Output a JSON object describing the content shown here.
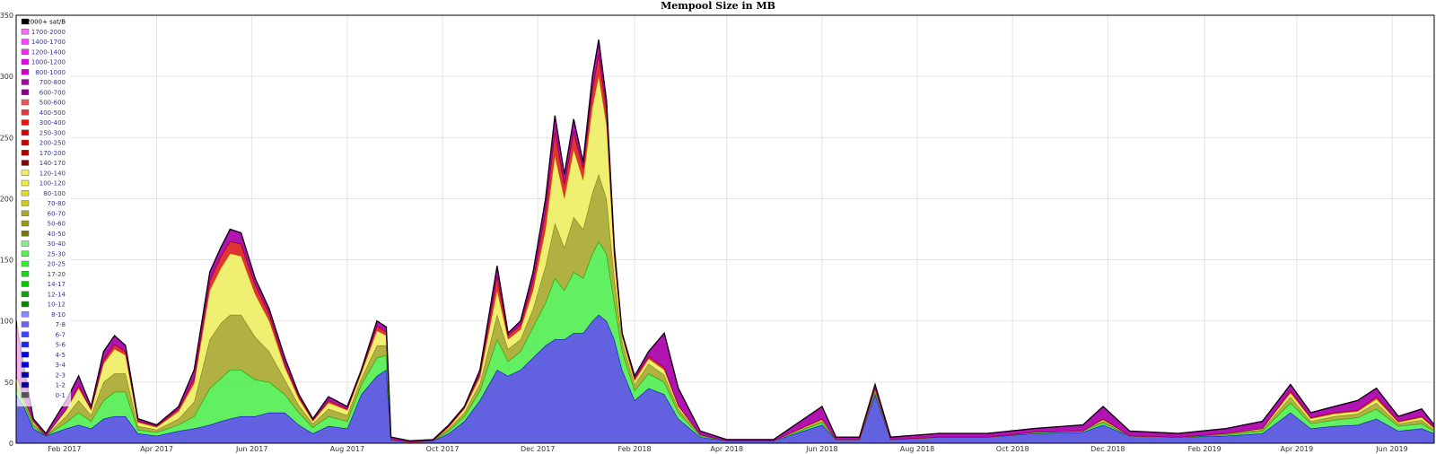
{
  "chart_data": {
    "type": "area",
    "title": "Mempool Size in MB",
    "xlabel": "",
    "ylabel": "",
    "stacked": true,
    "ylim": [
      0,
      350
    ],
    "yticks": [
      0,
      50,
      100,
      150,
      200,
      250,
      300,
      350
    ],
    "xlim": [
      "2017-01-01",
      "2019-06-28"
    ],
    "xticks": [
      {
        "date": "2017-02-01",
        "label": "Feb 2017"
      },
      {
        "date": "2017-04-01",
        "label": "Apr 2017"
      },
      {
        "date": "2017-06-01",
        "label": "Jun 2017"
      },
      {
        "date": "2017-08-01",
        "label": "Aug 2017"
      },
      {
        "date": "2017-10-01",
        "label": "Oct 2017"
      },
      {
        "date": "2017-12-01",
        "label": "Dec 2017"
      },
      {
        "date": "2018-02-01",
        "label": "Feb 2018"
      },
      {
        "date": "2018-04-01",
        "label": "Apr 2018"
      },
      {
        "date": "2018-06-01",
        "label": "Jun 2018"
      },
      {
        "date": "2018-08-01",
        "label": "Aug 2018"
      },
      {
        "date": "2018-10-01",
        "label": "Oct 2018"
      },
      {
        "date": "2018-12-01",
        "label": "Dec 2018"
      },
      {
        "date": "2019-02-01",
        "label": "Feb 2019"
      },
      {
        "date": "2019-04-01",
        "label": "Apr 2019"
      },
      {
        "date": "2019-06-01",
        "label": "Jun 2019"
      }
    ],
    "grid": true,
    "legend_position": "top-left",
    "legend": [
      {
        "label": "2000+ sat/B",
        "color": "#000000"
      },
      {
        "label": "1700-2000",
        "color": "#ff66ff"
      },
      {
        "label": "1400-1700",
        "color": "#ff44ff"
      },
      {
        "label": "1200-1400",
        "color": "#ff22ff"
      },
      {
        "label": "1000-1200",
        "color": "#ee00ee"
      },
      {
        "label": "800-1000",
        "color": "#cc00cc"
      },
      {
        "label": "700-800",
        "color": "#aa00aa"
      },
      {
        "label": "600-700",
        "color": "#880088"
      },
      {
        "label": "500-600",
        "color": "#ee5555"
      },
      {
        "label": "400-500",
        "color": "#ee3333"
      },
      {
        "label": "300-400",
        "color": "#ee1111"
      },
      {
        "label": "250-300",
        "color": "#dd0000"
      },
      {
        "label": "200-250",
        "color": "#cc0000"
      },
      {
        "label": "170-200",
        "color": "#aa0000"
      },
      {
        "label": "140-170",
        "color": "#880000"
      },
      {
        "label": "120-140",
        "color": "#eeee66"
      },
      {
        "label": "100-120",
        "color": "#eeee44"
      },
      {
        "label": "80-100",
        "color": "#dddd22"
      },
      {
        "label": "70-80",
        "color": "#cccc22"
      },
      {
        "label": "60-70",
        "color": "#aaaa22"
      },
      {
        "label": "50-60",
        "color": "#999911"
      },
      {
        "label": "40-50",
        "color": "#777711"
      },
      {
        "label": "30-40",
        "color": "#88ee88"
      },
      {
        "label": "25-30",
        "color": "#55ee55"
      },
      {
        "label": "20-25",
        "color": "#33ee33"
      },
      {
        "label": "17-20",
        "color": "#11dd11"
      },
      {
        "label": "14-17",
        "color": "#00cc00"
      },
      {
        "label": "12-14",
        "color": "#00aa00"
      },
      {
        "label": "10-12",
        "color": "#008800"
      },
      {
        "label": "8-10",
        "color": "#8888ff"
      },
      {
        "label": "7-8",
        "color": "#6666ff"
      },
      {
        "label": "6-7",
        "color": "#4444ff"
      },
      {
        "label": "5-6",
        "color": "#2222ff"
      },
      {
        "label": "4-5",
        "color": "#0000ff"
      },
      {
        "label": "3-4",
        "color": "#0000dd"
      },
      {
        "label": "2-3",
        "color": "#0000bb"
      },
      {
        "label": "1-2",
        "color": "#000099"
      },
      {
        "label": "0-1",
        "color": "#555555"
      }
    ],
    "series_groups": [
      {
        "name": "blue",
        "color": "#5555dd",
        "line": "#0000cc"
      },
      {
        "name": "green",
        "color": "#55ee55",
        "line": "#00aa00"
      },
      {
        "name": "olive",
        "color": "#aaaa33",
        "line": "#777711"
      },
      {
        "name": "yellow",
        "color": "#eeee66",
        "line": "#cccc22"
      },
      {
        "name": "red",
        "color": "#dd2222",
        "line": "#880000"
      },
      {
        "name": "purple",
        "color": "#aa00aa",
        "line": "#330033"
      }
    ],
    "points": [
      {
        "date": "2017-01-01",
        "total": 100,
        "blue": 40,
        "green": 5,
        "olive": 5,
        "yellow": 5,
        "red": 0
      },
      {
        "date": "2017-01-06",
        "total": 62,
        "blue": 30,
        "green": 3,
        "olive": 2,
        "yellow": 2,
        "red": 0
      },
      {
        "date": "2017-01-12",
        "total": 20,
        "blue": 12,
        "green": 2,
        "olive": 2,
        "yellow": 2,
        "red": 0
      },
      {
        "date": "2017-01-20",
        "total": 8,
        "blue": 6,
        "green": 0,
        "olive": 0,
        "yellow": 0,
        "red": 0
      },
      {
        "date": "2017-02-02",
        "total": 35,
        "blue": 12,
        "green": 5,
        "olive": 5,
        "yellow": 5,
        "red": 1
      },
      {
        "date": "2017-02-10",
        "total": 55,
        "blue": 15,
        "green": 10,
        "olive": 10,
        "yellow": 10,
        "red": 2
      },
      {
        "date": "2017-02-18",
        "total": 30,
        "blue": 12,
        "green": 6,
        "olive": 5,
        "yellow": 4,
        "red": 1
      },
      {
        "date": "2017-02-26",
        "total": 75,
        "blue": 20,
        "green": 15,
        "olive": 15,
        "yellow": 15,
        "red": 3
      },
      {
        "date": "2017-03-05",
        "total": 88,
        "blue": 22,
        "green": 20,
        "olive": 15,
        "yellow": 20,
        "red": 4
      },
      {
        "date": "2017-03-12",
        "total": 80,
        "blue": 22,
        "green": 20,
        "olive": 15,
        "yellow": 15,
        "red": 3
      },
      {
        "date": "2017-03-20",
        "total": 20,
        "blue": 8,
        "green": 3,
        "olive": 3,
        "yellow": 3,
        "red": 1
      },
      {
        "date": "2017-04-01",
        "total": 15,
        "blue": 6,
        "green": 3,
        "olive": 2,
        "yellow": 2,
        "red": 1
      },
      {
        "date": "2017-04-15",
        "total": 30,
        "blue": 10,
        "green": 5,
        "olive": 5,
        "yellow": 6,
        "red": 2
      },
      {
        "date": "2017-04-25",
        "total": 60,
        "blue": 12,
        "green": 10,
        "olive": 12,
        "yellow": 15,
        "red": 4
      },
      {
        "date": "2017-05-05",
        "total": 140,
        "blue": 15,
        "green": 30,
        "olive": 40,
        "yellow": 40,
        "red": 8
      },
      {
        "date": "2017-05-12",
        "total": 160,
        "blue": 18,
        "green": 35,
        "olive": 45,
        "yellow": 45,
        "red": 10
      },
      {
        "date": "2017-05-18",
        "total": 175,
        "blue": 20,
        "green": 40,
        "olive": 45,
        "yellow": 50,
        "red": 10
      },
      {
        "date": "2017-05-25",
        "total": 172,
        "blue": 22,
        "green": 38,
        "olive": 45,
        "yellow": 48,
        "red": 10
      },
      {
        "date": "2017-06-03",
        "total": 135,
        "blue": 22,
        "green": 30,
        "olive": 35,
        "yellow": 35,
        "red": 8
      },
      {
        "date": "2017-06-12",
        "total": 110,
        "blue": 25,
        "green": 25,
        "olive": 25,
        "yellow": 25,
        "red": 6
      },
      {
        "date": "2017-06-22",
        "total": 70,
        "blue": 25,
        "green": 15,
        "olive": 12,
        "yellow": 10,
        "red": 3
      },
      {
        "date": "2017-07-01",
        "total": 40,
        "blue": 15,
        "green": 10,
        "olive": 6,
        "yellow": 5,
        "red": 2
      },
      {
        "date": "2017-07-10",
        "total": 20,
        "blue": 8,
        "green": 5,
        "olive": 3,
        "yellow": 2,
        "red": 1
      },
      {
        "date": "2017-07-20",
        "total": 38,
        "blue": 14,
        "green": 8,
        "olive": 6,
        "yellow": 5,
        "red": 2
      },
      {
        "date": "2017-08-01",
        "total": 30,
        "blue": 12,
        "green": 6,
        "olive": 5,
        "yellow": 4,
        "red": 1
      },
      {
        "date": "2017-08-10",
        "total": 60,
        "blue": 40,
        "green": 8,
        "olive": 5,
        "yellow": 4,
        "red": 2
      },
      {
        "date": "2017-08-20",
        "total": 100,
        "blue": 55,
        "green": 15,
        "olive": 10,
        "yellow": 12,
        "red": 4
      },
      {
        "date": "2017-08-26",
        "total": 95,
        "blue": 60,
        "green": 12,
        "olive": 8,
        "yellow": 8,
        "red": 3
      },
      {
        "date": "2017-08-29",
        "total": 5,
        "blue": 3,
        "green": 0,
        "olive": 0,
        "yellow": 0,
        "red": 0
      },
      {
        "date": "2017-09-10",
        "total": 2,
        "blue": 1,
        "green": 0,
        "olive": 0,
        "yellow": 0,
        "red": 0
      },
      {
        "date": "2017-09-25",
        "total": 3,
        "blue": 2,
        "green": 0,
        "olive": 0,
        "yellow": 0,
        "red": 0
      },
      {
        "date": "2017-10-05",
        "total": 15,
        "blue": 8,
        "green": 2,
        "olive": 2,
        "yellow": 1,
        "red": 1
      },
      {
        "date": "2017-10-15",
        "total": 30,
        "blue": 18,
        "green": 4,
        "olive": 3,
        "yellow": 3,
        "red": 1
      },
      {
        "date": "2017-10-25",
        "total": 60,
        "blue": 35,
        "green": 8,
        "olive": 6,
        "yellow": 5,
        "red": 3
      },
      {
        "date": "2017-11-05",
        "total": 145,
        "blue": 60,
        "green": 25,
        "olive": 20,
        "yellow": 20,
        "red": 12
      },
      {
        "date": "2017-11-12",
        "total": 90,
        "blue": 55,
        "green": 12,
        "olive": 10,
        "yellow": 8,
        "red": 3
      },
      {
        "date": "2017-11-20",
        "total": 100,
        "blue": 60,
        "green": 15,
        "olive": 10,
        "yellow": 8,
        "red": 4
      },
      {
        "date": "2017-11-28",
        "total": 140,
        "blue": 70,
        "green": 25,
        "olive": 15,
        "yellow": 15,
        "red": 8
      },
      {
        "date": "2017-12-06",
        "total": 200,
        "blue": 80,
        "green": 35,
        "olive": 30,
        "yellow": 30,
        "red": 15
      },
      {
        "date": "2017-12-12",
        "total": 268,
        "blue": 85,
        "green": 50,
        "olive": 45,
        "yellow": 55,
        "red": 20
      },
      {
        "date": "2017-12-18",
        "total": 220,
        "blue": 85,
        "green": 40,
        "olive": 35,
        "yellow": 40,
        "red": 12
      },
      {
        "date": "2017-12-24",
        "total": 265,
        "blue": 90,
        "green": 50,
        "olive": 45,
        "yellow": 55,
        "red": 15
      },
      {
        "date": "2017-12-30",
        "total": 230,
        "blue": 90,
        "green": 45,
        "olive": 40,
        "yellow": 40,
        "red": 10
      },
      {
        "date": "2018-01-05",
        "total": 300,
        "blue": 100,
        "green": 55,
        "olive": 50,
        "yellow": 70,
        "red": 15
      },
      {
        "date": "2018-01-09",
        "total": 330,
        "blue": 105,
        "green": 60,
        "olive": 55,
        "yellow": 80,
        "red": 18
      },
      {
        "date": "2018-01-14",
        "total": 280,
        "blue": 100,
        "green": 55,
        "olive": 45,
        "yellow": 60,
        "red": 12
      },
      {
        "date": "2018-01-19",
        "total": 160,
        "blue": 85,
        "green": 30,
        "olive": 20,
        "yellow": 15,
        "red": 5
      },
      {
        "date": "2018-01-24",
        "total": 90,
        "blue": 60,
        "green": 15,
        "olive": 8,
        "yellow": 4,
        "red": 2
      },
      {
        "date": "2018-02-01",
        "total": 55,
        "blue": 35,
        "green": 8,
        "olive": 5,
        "yellow": 3,
        "red": 2
      },
      {
        "date": "2018-02-10",
        "total": 75,
        "blue": 45,
        "green": 12,
        "olive": 8,
        "yellow": 4,
        "red": 2
      },
      {
        "date": "2018-02-20",
        "total": 90,
        "blue": 40,
        "green": 10,
        "olive": 6,
        "yellow": 4,
        "red": 2
      },
      {
        "date": "2018-03-01",
        "total": 45,
        "blue": 20,
        "green": 5,
        "olive": 3,
        "yellow": 2,
        "red": 1
      },
      {
        "date": "2018-03-15",
        "total": 10,
        "blue": 5,
        "green": 1,
        "olive": 1,
        "yellow": 0,
        "red": 0
      },
      {
        "date": "2018-04-01",
        "total": 3,
        "blue": 2,
        "green": 0,
        "olive": 0,
        "yellow": 0,
        "red": 0
      },
      {
        "date": "2018-05-01",
        "total": 3,
        "blue": 2,
        "green": 0,
        "olive": 0,
        "yellow": 0,
        "red": 0
      },
      {
        "date": "2018-06-01",
        "total": 30,
        "blue": 15,
        "green": 2,
        "olive": 1,
        "yellow": 1,
        "red": 1
      },
      {
        "date": "2018-06-10",
        "total": 5,
        "blue": 3,
        "green": 0,
        "olive": 0,
        "yellow": 0,
        "red": 0
      },
      {
        "date": "2018-06-25",
        "total": 5,
        "blue": 3,
        "green": 0,
        "olive": 0,
        "yellow": 0,
        "red": 0
      },
      {
        "date": "2018-07-05",
        "total": 48,
        "blue": 40,
        "green": 2,
        "olive": 1,
        "yellow": 1,
        "red": 1
      },
      {
        "date": "2018-07-15",
        "total": 5,
        "blue": 3,
        "green": 0,
        "olive": 0,
        "yellow": 0,
        "red": 0
      },
      {
        "date": "2018-08-15",
        "total": 8,
        "blue": 5,
        "green": 0,
        "olive": 0,
        "yellow": 0,
        "red": 0
      },
      {
        "date": "2018-09-15",
        "total": 8,
        "blue": 5,
        "green": 0,
        "olive": 0,
        "yellow": 0,
        "red": 0
      },
      {
        "date": "2018-10-15",
        "total": 12,
        "blue": 8,
        "green": 1,
        "olive": 0,
        "yellow": 0,
        "red": 0
      },
      {
        "date": "2018-11-15",
        "total": 15,
        "blue": 9,
        "green": 1,
        "olive": 0,
        "yellow": 0,
        "red": 0
      },
      {
        "date": "2018-11-28",
        "total": 30,
        "blue": 15,
        "green": 2,
        "olive": 1,
        "yellow": 1,
        "red": 1
      },
      {
        "date": "2018-12-15",
        "total": 10,
        "blue": 6,
        "green": 0,
        "olive": 0,
        "yellow": 0,
        "red": 0
      },
      {
        "date": "2019-01-15",
        "total": 8,
        "blue": 5,
        "green": 0,
        "olive": 0,
        "yellow": 0,
        "red": 0
      },
      {
        "date": "2019-02-15",
        "total": 12,
        "blue": 6,
        "green": 1,
        "olive": 1,
        "yellow": 0,
        "red": 0
      },
      {
        "date": "2019-03-10",
        "total": 18,
        "blue": 8,
        "green": 2,
        "olive": 1,
        "yellow": 1,
        "red": 0
      },
      {
        "date": "2019-03-28",
        "total": 48,
        "blue": 25,
        "green": 8,
        "olive": 5,
        "yellow": 3,
        "red": 2
      },
      {
        "date": "2019-04-10",
        "total": 25,
        "blue": 12,
        "green": 4,
        "olive": 2,
        "yellow": 2,
        "red": 1
      },
      {
        "date": "2019-04-25",
        "total": 30,
        "blue": 14,
        "green": 5,
        "olive": 3,
        "yellow": 2,
        "red": 1
      },
      {
        "date": "2019-05-10",
        "total": 35,
        "blue": 15,
        "green": 6,
        "olive": 3,
        "yellow": 2,
        "red": 1
      },
      {
        "date": "2019-05-22",
        "total": 45,
        "blue": 20,
        "green": 8,
        "olive": 5,
        "yellow": 3,
        "red": 2
      },
      {
        "date": "2019-06-05",
        "total": 22,
        "blue": 10,
        "green": 4,
        "olive": 2,
        "yellow": 1,
        "red": 1
      },
      {
        "date": "2019-06-20",
        "total": 28,
        "blue": 12,
        "green": 4,
        "olive": 3,
        "yellow": 2,
        "red": 1
      },
      {
        "date": "2019-06-28",
        "total": 15,
        "blue": 8,
        "green": 2,
        "olive": 1,
        "yellow": 1,
        "red": 1
      }
    ]
  }
}
